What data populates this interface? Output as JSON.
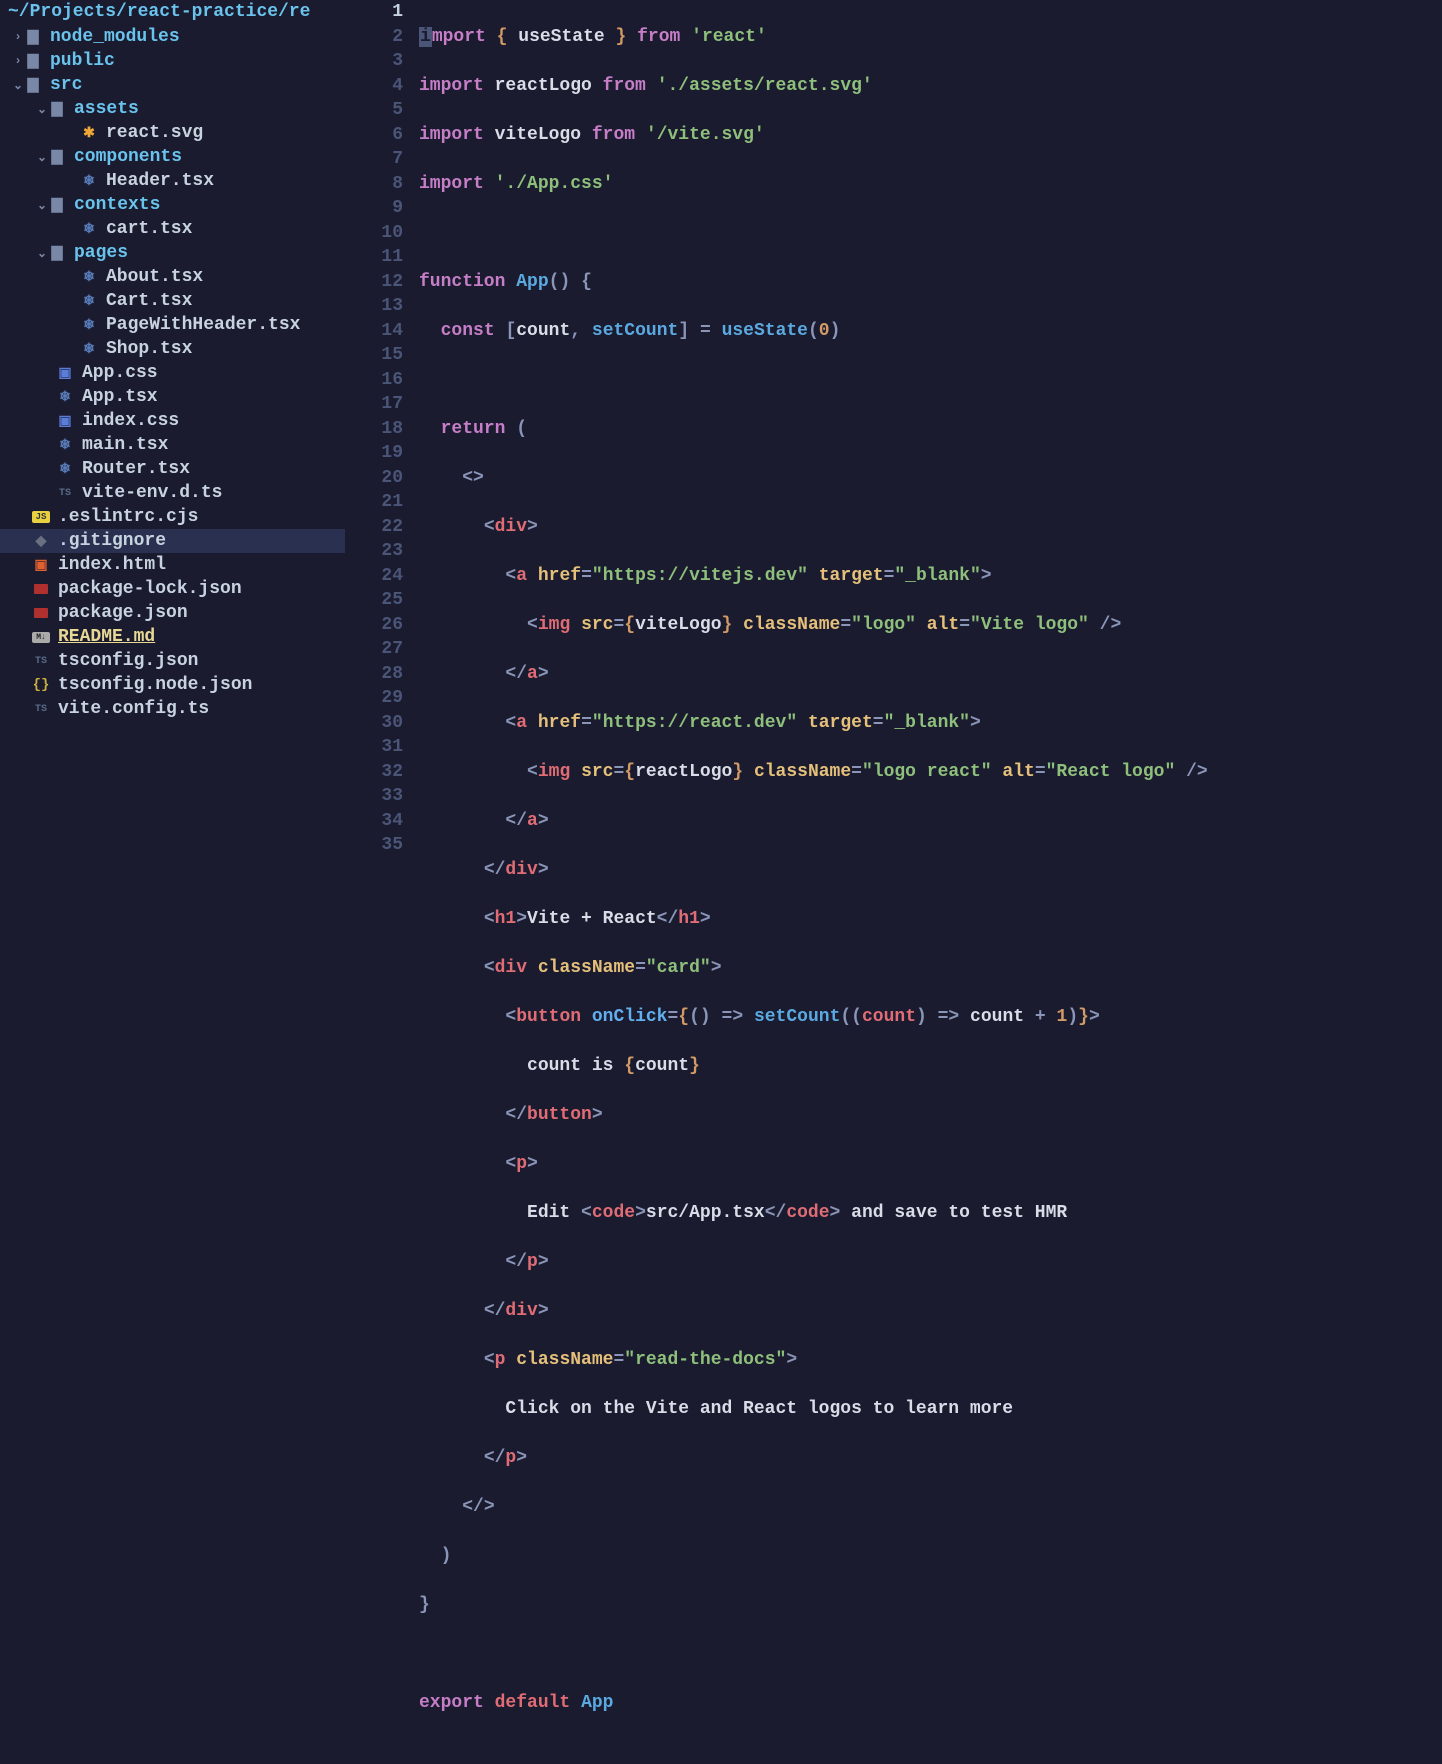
{
  "path": "~/Projects/react-practice/re",
  "tree": {
    "node_modules": "node_modules",
    "public": "public",
    "src": "src",
    "assets": "assets",
    "react_svg": "react.svg",
    "components": "components",
    "header_tsx": "Header.tsx",
    "contexts": "contexts",
    "cart_tsx": "cart.tsx",
    "pages": "pages",
    "about": "About.tsx",
    "cart2": "Cart.tsx",
    "pwh": "PageWithHeader.tsx",
    "shop": "Shop.tsx",
    "appcss": "App.css",
    "apptsx": "App.tsx",
    "indexcss": "index.css",
    "maintsx": "main.tsx",
    "router": "Router.tsx",
    "viteenv": "vite-env.d.ts",
    "eslint": ".eslintrc.cjs",
    "gitignore": ".gitignore",
    "indexhtml": "index.html",
    "pkglock": "package-lock.json",
    "pkg": "package.json",
    "readme": "README.md",
    "tsconfig": "tsconfig.json",
    "tsconfignode": "tsconfig.node.json",
    "viteconfig": "vite.config.ts"
  },
  "code": {
    "l1_import": "import",
    "l1_useState": "useState",
    "l1_from": "from",
    "l1_react": "'react'",
    "l2_import": "import",
    "l2_id": "reactLogo",
    "l2_from": "from",
    "l2_str": "'./assets/react.svg'",
    "l3_import": "import",
    "l3_id": "viteLogo",
    "l3_from": "from",
    "l3_str": "'/vite.svg'",
    "l4_import": "import",
    "l4_str": "'./App.css'",
    "l6_fn": "function",
    "l6_app": "App",
    "l7_const": "const",
    "l7_count": "count",
    "l7_setcount": "setCount",
    "l7_usestate": "useState",
    "l7_zero": "0",
    "l9_return": "return",
    "l11_div": "div",
    "l12_a": "a",
    "l12_href": "href",
    "l12_url": "\"https://vitejs.dev\"",
    "l12_target": "target",
    "l12_blank": "\"_blank\"",
    "l13_img": "img",
    "l13_src": "src",
    "l13_vl": "viteLogo",
    "l13_cn": "className",
    "l13_logo": "\"logo\"",
    "l13_alt": "alt",
    "l13_altv": "\"Vite logo\"",
    "l14_a": "a",
    "l15_a": "a",
    "l15_href": "href",
    "l15_url": "\"https://react.dev\"",
    "l15_target": "target",
    "l15_blank": "\"_blank\"",
    "l16_img": "img",
    "l16_src": "src",
    "l16_rl": "reactLogo",
    "l16_cn": "className",
    "l16_logor": "\"logo react\"",
    "l16_alt": "alt",
    "l16_altv": "\"React logo\"",
    "l17_a": "a",
    "l18_div": "div",
    "l19_h1": "h1",
    "l19_txt": "Vite + React",
    "l20_div": "div",
    "l20_cn": "className",
    "l20_card": "\"card\"",
    "l21_btn": "button",
    "l21_oc": "onClick",
    "l21_sc": "setCount",
    "l21_count": "count",
    "l21_count2": "count",
    "l21_one": "1",
    "l22_txt": "count is ",
    "l22_count": "count",
    "l23_btn": "button",
    "l24_p": "p",
    "l25_txt1": "Edit ",
    "l25_code": "code",
    "l25_path": "src/App.tsx",
    "l25_txt2": " and save to test HMR",
    "l26_p": "p",
    "l27_div": "div",
    "l28_p": "p",
    "l28_cn": "className",
    "l28_rtd": "\"read-the-docs\"",
    "l29_txt": "Click on the Vite and React logos to learn more",
    "l30_p": "p",
    "l35_export": "export",
    "l35_default": "default",
    "l35_app": "App"
  }
}
